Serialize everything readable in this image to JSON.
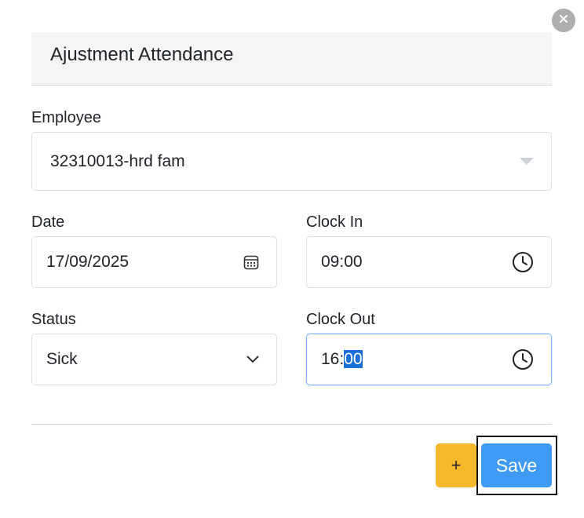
{
  "modal": {
    "title": "Ajustment Attendance",
    "close_icon": "close-icon"
  },
  "form": {
    "employee": {
      "label": "Employee",
      "value": "32310013-hrd fam",
      "icon": "caret-down-icon"
    },
    "date": {
      "label": "Date",
      "value": "17/09/2025",
      "icon": "calendar-icon"
    },
    "clock_in": {
      "label": "Clock In",
      "value": "09:00",
      "icon": "clock-icon"
    },
    "status": {
      "label": "Status",
      "value": "Sick",
      "icon": "chevron-down-icon"
    },
    "clock_out": {
      "label": "Clock Out",
      "value_hours": "16:",
      "value_minutes": "00",
      "icon": "clock-icon"
    }
  },
  "footer": {
    "add_label": "+",
    "save_label": "Save"
  },
  "colors": {
    "add_button": "#f7b92c",
    "save_button": "#3f9af5",
    "close_button": "#aeaeae",
    "header_bg": "#f5f5f5",
    "selection": "#1a6fd8"
  }
}
